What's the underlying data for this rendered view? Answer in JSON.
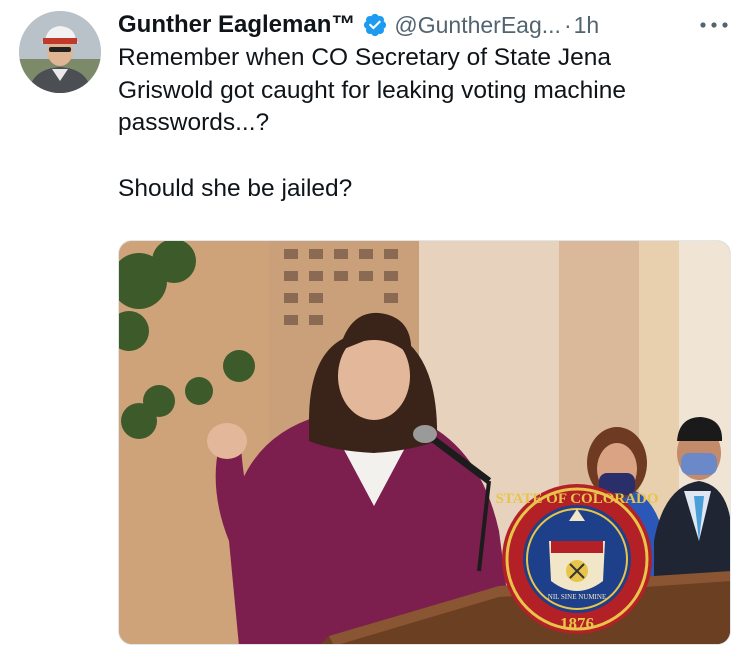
{
  "author": {
    "display_name": "Gunther Eagleman™",
    "handle": "@GuntherEag...",
    "separator": "·",
    "timestamp": "1h",
    "verified": true,
    "avatar_icon": "profile-photo"
  },
  "tweet": {
    "text_lines": [
      "Remember when CO Secretary of State Jena",
      "Griswold got caught for leaking voting machine",
      "passwords...?"
    ],
    "text_question": "Should she be jailed?"
  },
  "media": {
    "seal_text_top": "STATE OF COLORADO",
    "seal_year": "1876",
    "seal_motto": "NIL SINE NUMINE"
  },
  "colors": {
    "verified_blue": "#1d9bf0",
    "secondary_text": "#536471",
    "primary_text": "#0f1419"
  },
  "icons": {
    "verified": "verified-badge-icon",
    "more": "more-horizontal-icon"
  }
}
